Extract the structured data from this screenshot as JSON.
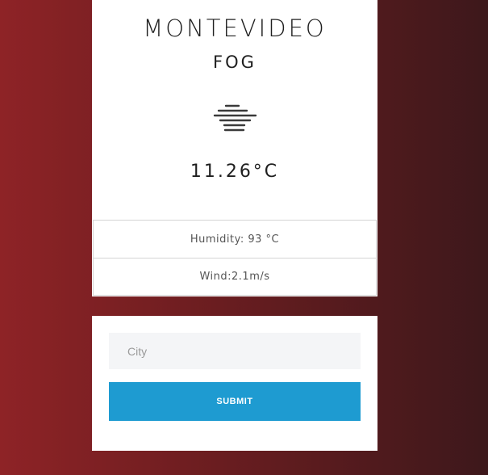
{
  "weather": {
    "city": "MONTEVIDEO",
    "condition": "FOG",
    "icon": "fog-icon",
    "temperature": "11.26°C",
    "humidity": "Humidity: 93 °C",
    "wind": "Wind:2.1m/s"
  },
  "form": {
    "city_placeholder": "City",
    "city_value": "",
    "submit_label": "SUBMIT"
  },
  "colors": {
    "background_gradient_start": "#8e2326",
    "background_gradient_end": "#3d181b",
    "card": "#ffffff",
    "input_background": "#f4f5f7",
    "submit_button": "#1e9bd1",
    "text": "#1f1f1f"
  }
}
